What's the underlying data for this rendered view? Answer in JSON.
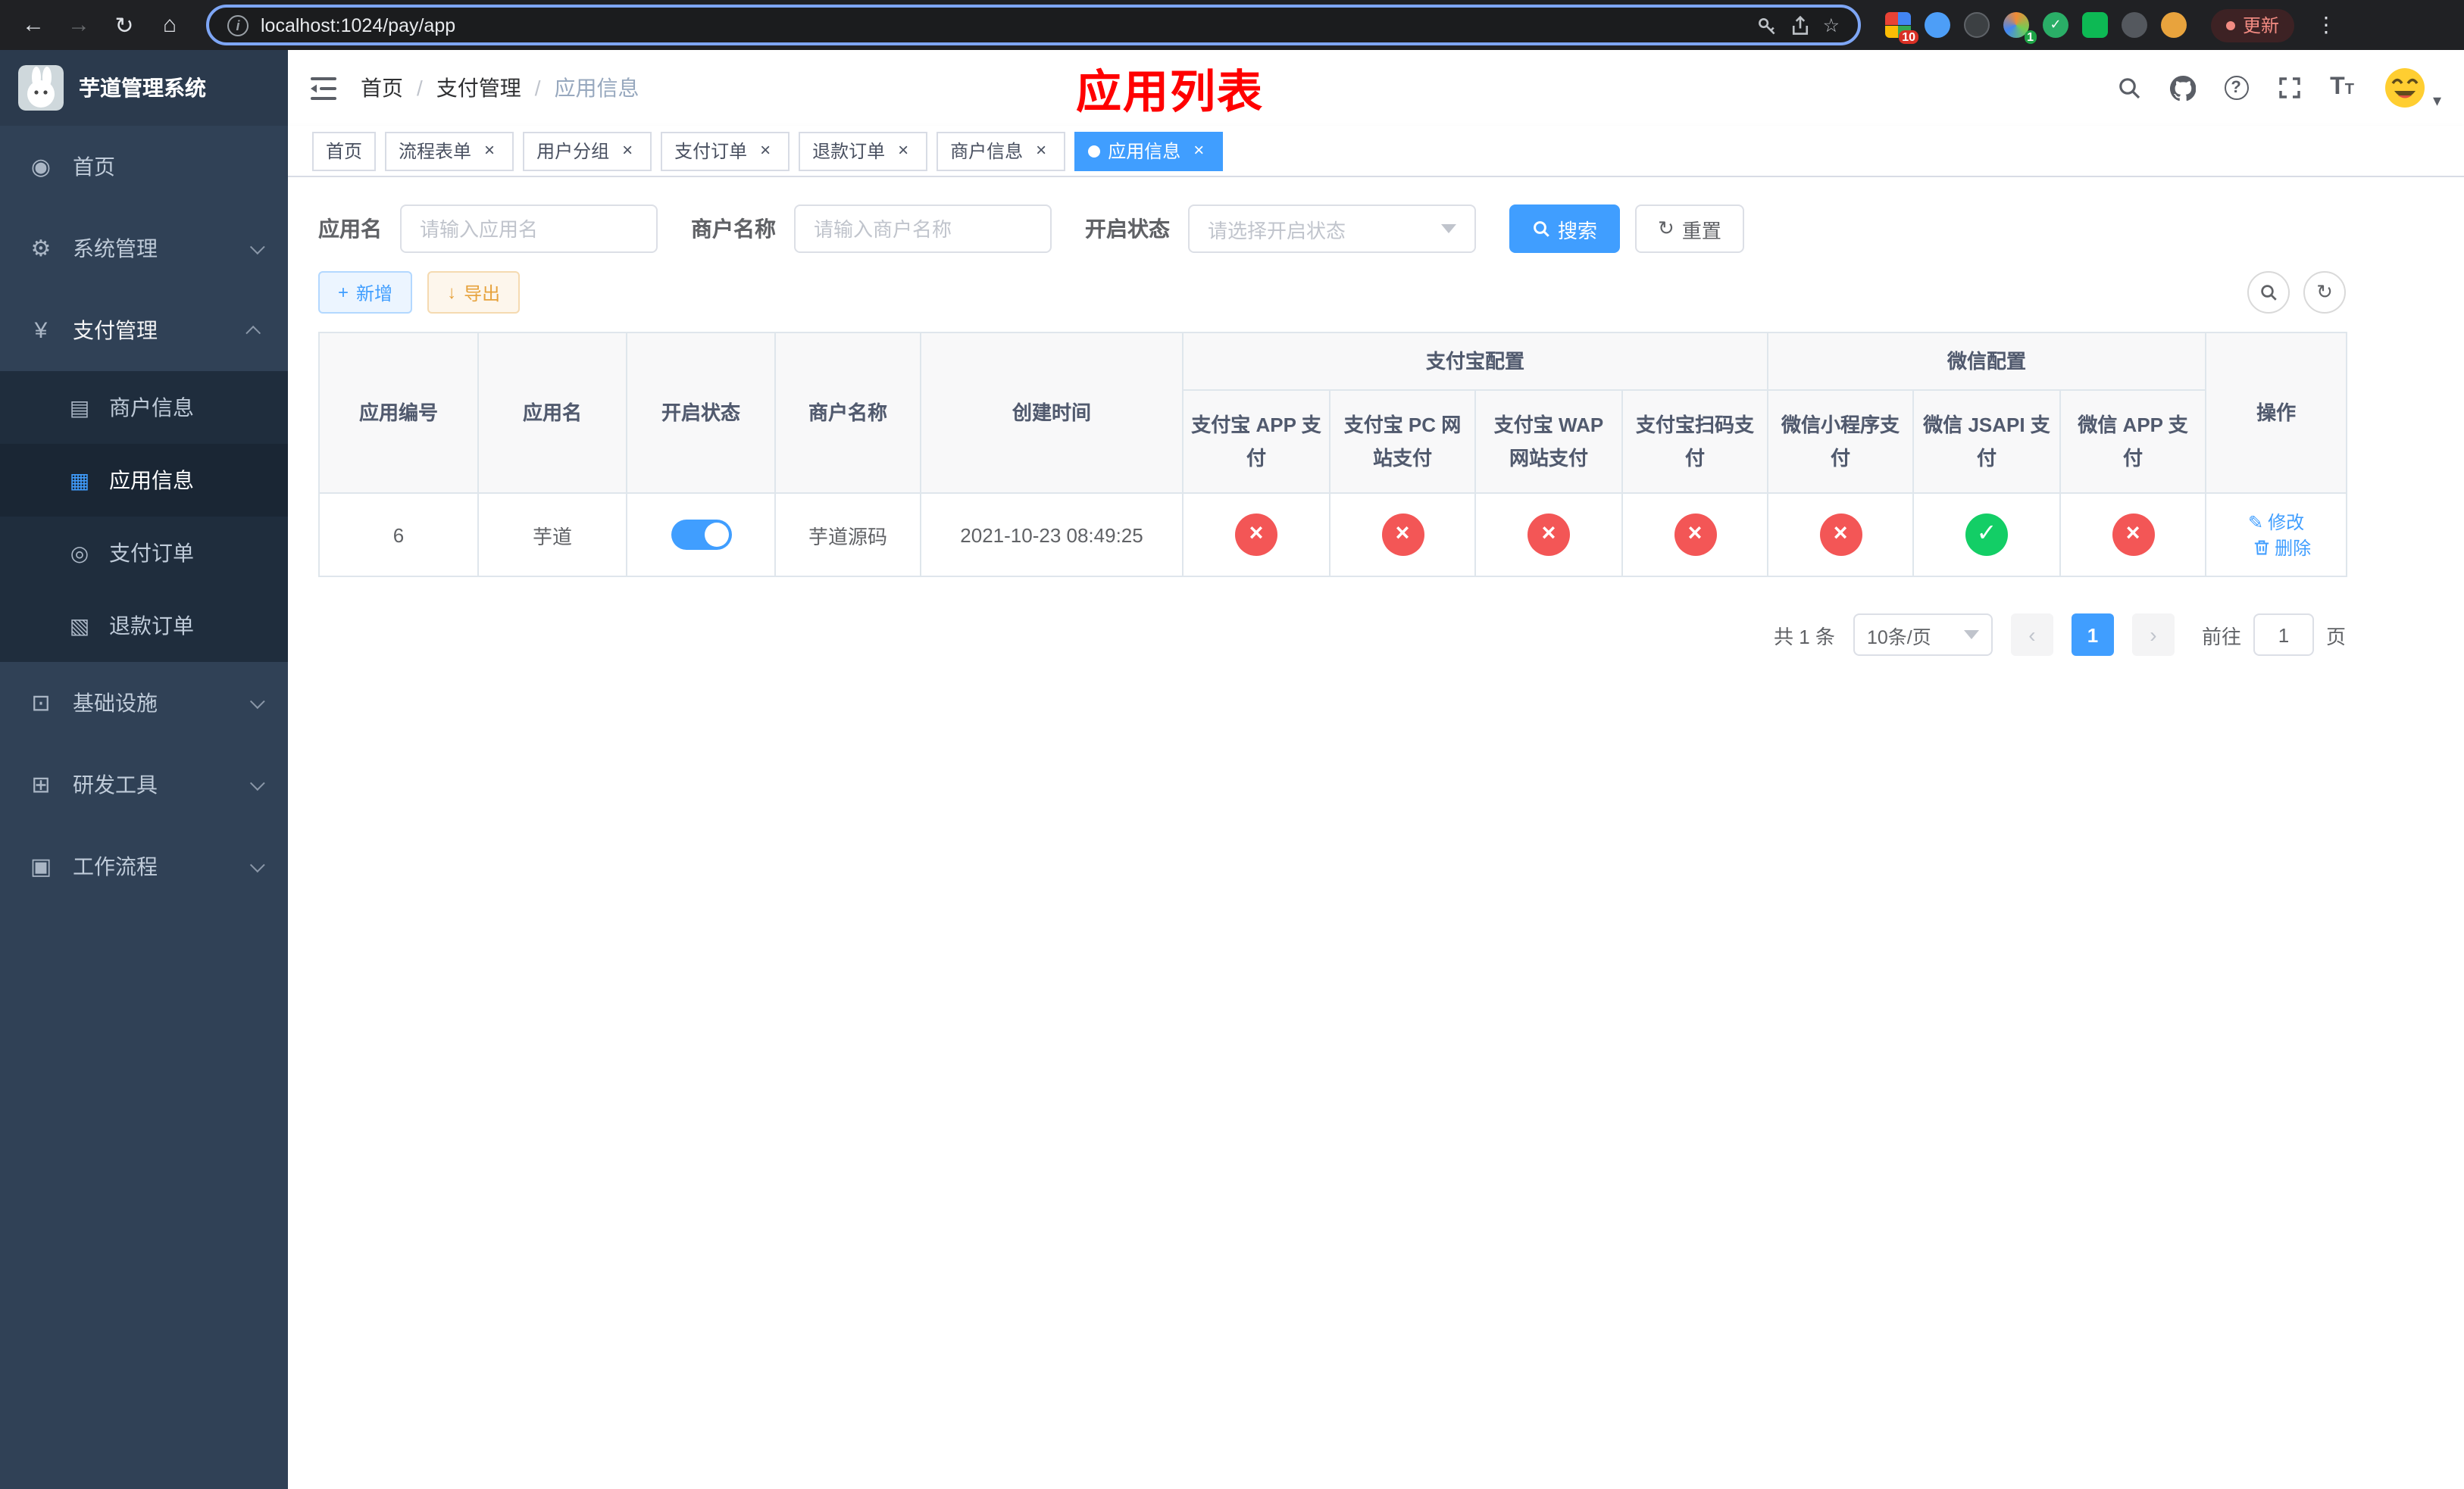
{
  "colors": {
    "primary": "#409eff",
    "danger": "#f35656",
    "success": "#13ce66",
    "warning": "#e6a23c",
    "sidebar_bg": "#304156",
    "submenu_bg": "#1f2d3d",
    "annotation_red": "#ff0000"
  },
  "icons": {
    "back": "←",
    "forward": "→",
    "reload": "↻",
    "home": "⌂",
    "info": "i",
    "star": "☆",
    "dots": "⋮",
    "close": "×",
    "plus": "+",
    "download": "↓",
    "refresh": "↻",
    "question": "?",
    "caret": "▾",
    "prev": "‹",
    "next": "›",
    "check": "✓",
    "edit": "✎",
    "font_big": "T",
    "font_small": "T"
  },
  "browser": {
    "url": "localhost:1024/pay/app",
    "update_label": "更新",
    "ext_badges": {
      "tabs": "10",
      "translate": "1"
    }
  },
  "sidebar": {
    "logo_title": "芋道管理系统",
    "menu": [
      {
        "icon": "◉",
        "label": "首页"
      },
      {
        "icon": "⚙",
        "label": "系统管理"
      },
      {
        "icon": "¥",
        "label": "支付管理"
      },
      {
        "icon": "⊡",
        "label": "基础设施"
      },
      {
        "icon": "⊞",
        "label": "研发工具"
      },
      {
        "icon": "▣",
        "label": "工作流程"
      }
    ],
    "submenu": [
      {
        "icon": "▤",
        "label": "商户信息"
      },
      {
        "icon": "▦",
        "label": "应用信息"
      },
      {
        "icon": "◎",
        "label": "支付订单"
      },
      {
        "icon": "▧",
        "label": "退款订单"
      }
    ]
  },
  "header": {
    "breadcrumb": [
      "首页",
      "支付管理",
      "应用信息"
    ],
    "separator": "/",
    "annotation": "应用列表"
  },
  "tabs": [
    {
      "label": "首页"
    },
    {
      "label": "流程表单"
    },
    {
      "label": "用户分组"
    },
    {
      "label": "支付订单"
    },
    {
      "label": "退款订单"
    },
    {
      "label": "商户信息"
    },
    {
      "label": "应用信息"
    }
  ],
  "filters": {
    "app_name_label": "应用名",
    "app_name_placeholder": "请输入应用名",
    "merchant_label": "商户名称",
    "merchant_placeholder": "请输入商户名称",
    "status_label": "开启状态",
    "status_placeholder": "请选择开启状态",
    "search_label": "搜索",
    "reset_label": "重置"
  },
  "toolbar": {
    "add_label": "新增",
    "export_label": "导出"
  },
  "table": {
    "main_headers": [
      "应用编号",
      "应用名",
      "开启状态",
      "商户名称",
      "创建时间"
    ],
    "group_headers": [
      {
        "label": "支付宝配置",
        "cols": [
          "支付宝 APP 支付",
          "支付宝 PC 网站支付",
          "支付宝 WAP 网站支付",
          "支付宝扫码支付"
        ]
      },
      {
        "label": "微信配置",
        "cols": [
          "微信小程序支付",
          "微信 JSAPI 支付",
          "微信 APP 支付"
        ]
      }
    ],
    "op_header": "操作",
    "row": {
      "id": "6",
      "name": "芋道",
      "enabled": true,
      "merchant": "芋道源码",
      "created": "2021-10-23 08:49:25",
      "statuses": [
        {
          "cls": "status-circle red",
          "glyph": "×"
        },
        {
          "cls": "status-circle red",
          "glyph": "×"
        },
        {
          "cls": "status-circle red",
          "glyph": "×"
        },
        {
          "cls": "status-circle red",
          "glyph": "×"
        },
        {
          "cls": "status-circle red",
          "glyph": "×"
        },
        {
          "cls": "status-circle green",
          "glyph": "✓"
        },
        {
          "cls": "status-circle red",
          "glyph": "×"
        }
      ],
      "actions": [
        {
          "label": "修改"
        },
        {
          "label": "删除"
        }
      ]
    }
  },
  "pagination": {
    "total": "共 1 条",
    "size": "10条/页",
    "page": "1",
    "goto": "前往",
    "goto_value": "1",
    "unit": "页"
  }
}
